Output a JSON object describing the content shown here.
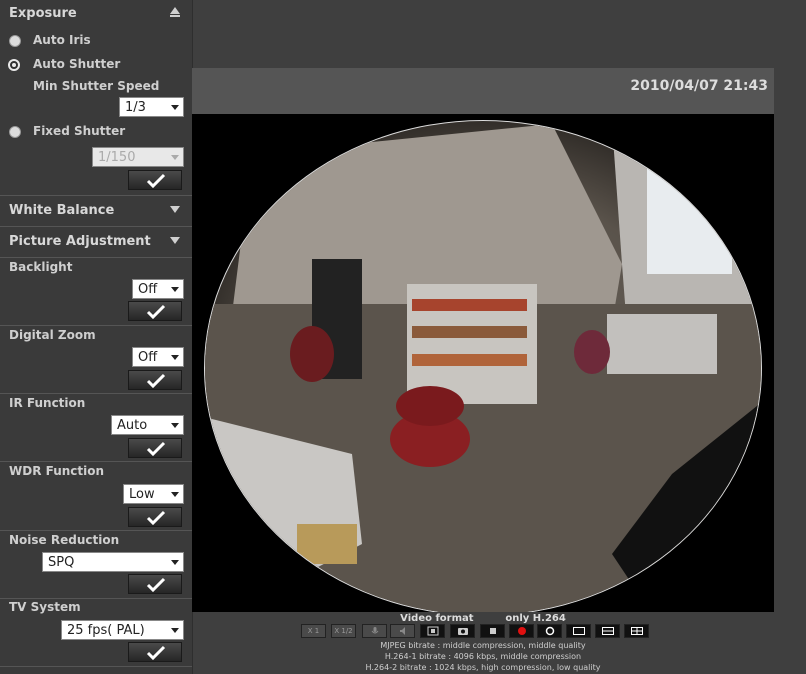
{
  "sidebar": {
    "exposure": {
      "title": "Exposure",
      "auto_iris": "Auto Iris",
      "auto_shutter": "Auto Shutter",
      "min_shutter_label": "Min Shutter Speed",
      "min_shutter_value": "1/3",
      "fixed_shutter": "Fixed Shutter",
      "fixed_shutter_value": "1/150"
    },
    "white_balance": "White Balance",
    "picture_adjustment": "Picture Adjustment",
    "backlight": {
      "label": "Backlight",
      "value": "Off"
    },
    "digital_zoom": {
      "label": "Digital Zoom",
      "value": "Off"
    },
    "ir_function": {
      "label": "IR Function",
      "value": "Auto"
    },
    "wdr_function": {
      "label": "WDR Function",
      "value": "Low"
    },
    "noise_reduction": {
      "label": "Noise Reduction",
      "value": "SPQ"
    },
    "tv_system": {
      "label": "TV System",
      "value": "25 fps( PAL)"
    }
  },
  "viewer": {
    "datetime": "2010/04/07 21:43",
    "video_format_label": "Video format",
    "video_format_value": "only H.264",
    "ctrl_x1": "X 1",
    "ctrl_x12": "X 1/2",
    "info_lines": [
      "MJPEG bitrate : middle compression, middle quality",
      "H.264-1 bitrate : 4096 kbps, middle compression",
      "H.264-2 bitrate : 1024 kbps, high compression, low quality"
    ]
  },
  "colors": {
    "accent_record": "#e01010",
    "panel": "#3a3a3a"
  }
}
